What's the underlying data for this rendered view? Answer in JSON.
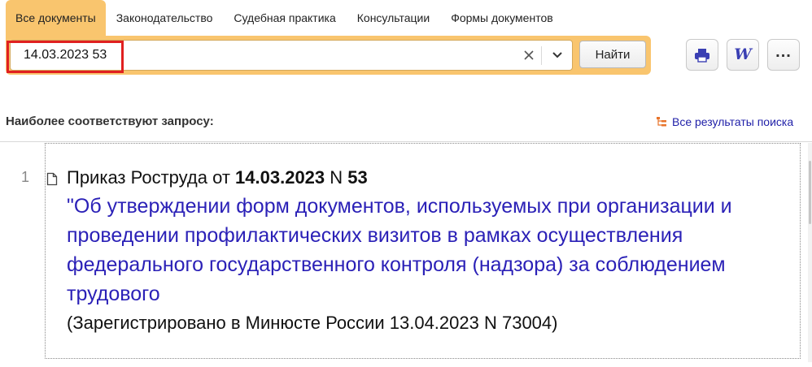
{
  "tabs": [
    {
      "label": "Все документы",
      "active": true
    },
    {
      "label": "Законодательство",
      "active": false
    },
    {
      "label": "Судебная практика",
      "active": false
    },
    {
      "label": "Консультации",
      "active": false
    },
    {
      "label": "Формы документов",
      "active": false
    }
  ],
  "search": {
    "value": "14.03.2023 53",
    "find_label": "Найти"
  },
  "toolbar": {
    "icons": [
      "print-icon",
      "word-export-icon",
      "more-icon"
    ],
    "word_glyph": "W",
    "more_glyph": "..."
  },
  "results_header": {
    "label": "Наиболее соответствуют запросу:",
    "all_results": "Все результаты поиска"
  },
  "result": {
    "number": "1",
    "prefix": "Приказ Роструда от ",
    "date": "14.03.2023",
    "n_label": " N ",
    "doc_number": "53",
    "title": "\"Об утверждении форм документов, используемых при организации и проведении профилактических визитов в рамках осуществления федерального государственного контроля (надзора) за соблюдением трудового",
    "note": "(Зарегистрировано в Минюсте России 13.04.2023 N 73004)"
  },
  "colors": {
    "accent": "#f9c56e",
    "link": "#2b21b7",
    "highlight_border": "#e02020"
  }
}
